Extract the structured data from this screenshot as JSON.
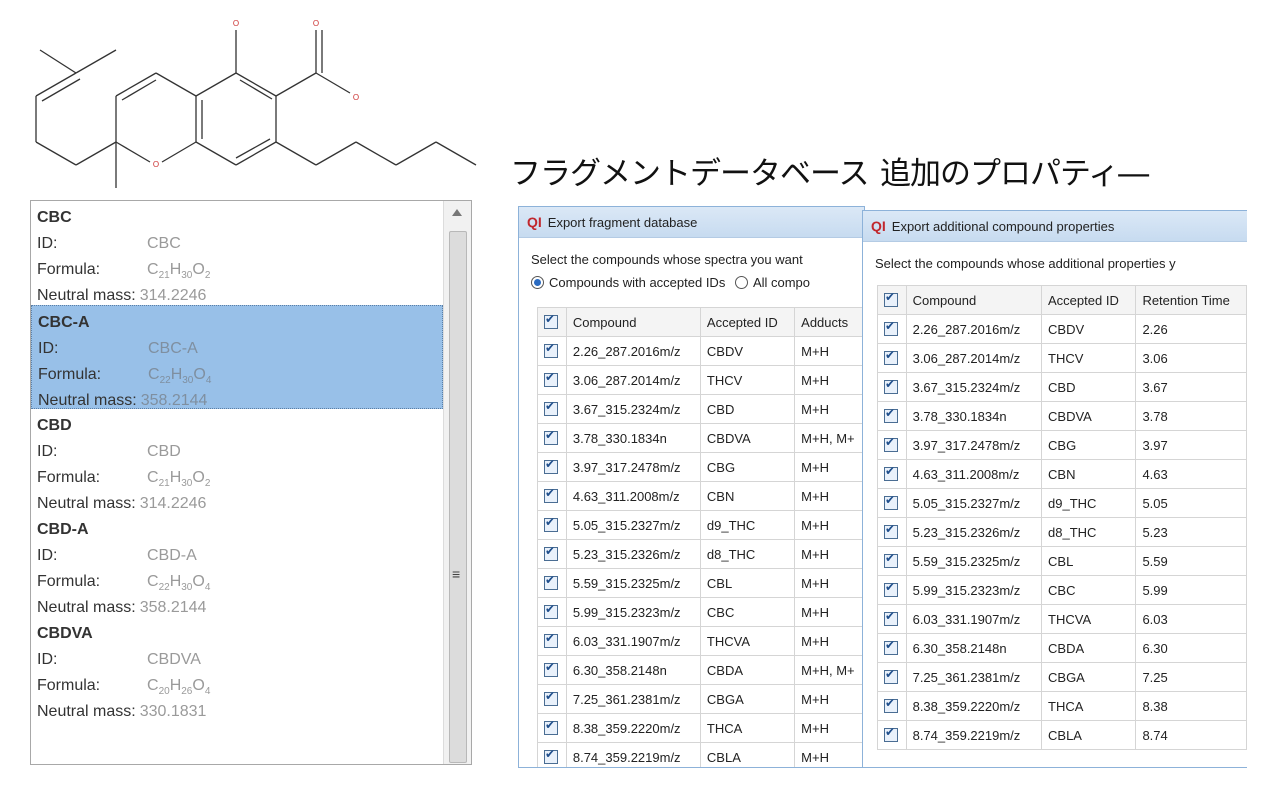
{
  "structure": {
    "atom_labels": [
      "O",
      "O",
      "O",
      "O"
    ]
  },
  "captions": {
    "fragment": "フラグメントデータベース",
    "properties": "追加のプロパティ―"
  },
  "compound_list": {
    "labels": {
      "id": "ID:",
      "formula": "Formula:",
      "mass": "Neutral mass:"
    },
    "items": [
      {
        "name": "CBC",
        "id": "CBC",
        "formula": [
          "C",
          "21",
          "H",
          "30",
          "O",
          "2"
        ],
        "mass": "314.2246",
        "selected": false
      },
      {
        "name": "CBC-A",
        "id": "CBC-A",
        "formula": [
          "C",
          "22",
          "H",
          "30",
          "O",
          "4"
        ],
        "mass": "358.2144",
        "selected": true
      },
      {
        "name": "CBD",
        "id": "CBD",
        "formula": [
          "C",
          "21",
          "H",
          "30",
          "O",
          "2"
        ],
        "mass": "314.2246",
        "selected": false
      },
      {
        "name": "CBD-A",
        "id": "CBD-A",
        "formula": [
          "C",
          "22",
          "H",
          "30",
          "O",
          "4"
        ],
        "mass": "358.2144",
        "selected": false
      },
      {
        "name": "CBDVA",
        "id": "CBDVA",
        "formula": [
          "C",
          "20",
          "H",
          "26",
          "O",
          "4"
        ],
        "mass": "330.1831",
        "selected": false
      }
    ]
  },
  "fragment_dialog": {
    "logo": "QI",
    "title": "Export fragment database",
    "prompt": "Select the compounds whose spectra you want",
    "radio_accepted": "Compounds with accepted IDs",
    "radio_all": "All compo",
    "columns": [
      "Compound",
      "Accepted ID",
      "Adducts"
    ],
    "rows": [
      [
        "2.26_287.2016m/z",
        "CBDV",
        "M+H"
      ],
      [
        "3.06_287.2014m/z",
        "THCV",
        "M+H"
      ],
      [
        "3.67_315.2324m/z",
        "CBD",
        "M+H"
      ],
      [
        "3.78_330.1834n",
        "CBDVA",
        "M+H, M+"
      ],
      [
        "3.97_317.2478m/z",
        "CBG",
        "M+H"
      ],
      [
        "4.63_311.2008m/z",
        "CBN",
        "M+H"
      ],
      [
        "5.05_315.2327m/z",
        "d9_THC",
        "M+H"
      ],
      [
        "5.23_315.2326m/z",
        "d8_THC",
        "M+H"
      ],
      [
        "5.59_315.2325m/z",
        "CBL",
        "M+H"
      ],
      [
        "5.99_315.2323m/z",
        "CBC",
        "M+H"
      ],
      [
        "6.03_331.1907m/z",
        "THCVA",
        "M+H"
      ],
      [
        "6.30_358.2148n",
        "CBDA",
        "M+H, M+"
      ],
      [
        "7.25_361.2381m/z",
        "CBGA",
        "M+H"
      ],
      [
        "8.38_359.2220m/z",
        "THCA",
        "M+H"
      ],
      [
        "8.74_359.2219m/z",
        "CBLA",
        "M+H"
      ]
    ]
  },
  "properties_dialog": {
    "logo": "QI",
    "title": "Export additional compound properties",
    "prompt": "Select the compounds whose additional properties y",
    "columns": [
      "Compound",
      "Accepted ID",
      "Retention Time"
    ],
    "rows": [
      [
        "2.26_287.2016m/z",
        "CBDV",
        "2.26"
      ],
      [
        "3.06_287.2014m/z",
        "THCV",
        "3.06"
      ],
      [
        "3.67_315.2324m/z",
        "CBD",
        "3.67"
      ],
      [
        "3.78_330.1834n",
        "CBDVA",
        "3.78"
      ],
      [
        "3.97_317.2478m/z",
        "CBG",
        "3.97"
      ],
      [
        "4.63_311.2008m/z",
        "CBN",
        "4.63"
      ],
      [
        "5.05_315.2327m/z",
        "d9_THC",
        "5.05"
      ],
      [
        "5.23_315.2326m/z",
        "d8_THC",
        "5.23"
      ],
      [
        "5.59_315.2325m/z",
        "CBL",
        "5.59"
      ],
      [
        "5.99_315.2323m/z",
        "CBC",
        "5.99"
      ],
      [
        "6.03_331.1907m/z",
        "THCVA",
        "6.03"
      ],
      [
        "6.30_358.2148n",
        "CBDA",
        "6.30"
      ],
      [
        "7.25_361.2381m/z",
        "CBGA",
        "7.25"
      ],
      [
        "8.38_359.2220m/z",
        "THCA",
        "8.38"
      ],
      [
        "8.74_359.2219m/z",
        "CBLA",
        "8.74"
      ]
    ]
  }
}
